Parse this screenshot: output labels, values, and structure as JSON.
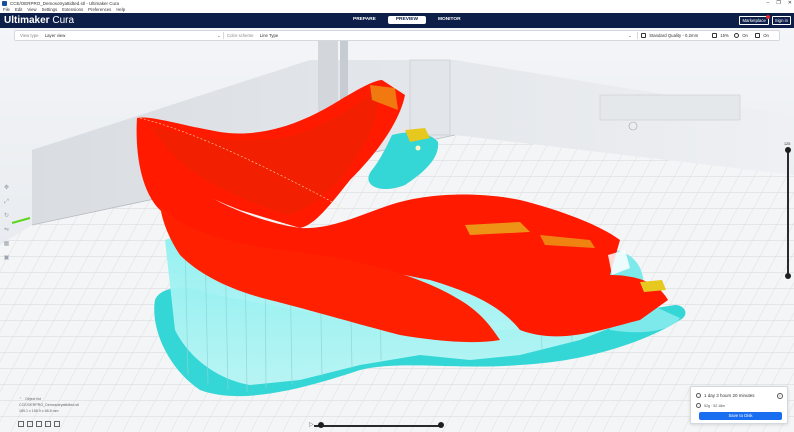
{
  "window": {
    "title": "CCE/OERPRO_Demosotryattidted.stl - Ultimaker Cura",
    "controls": [
      "–",
      "❐",
      "✕"
    ]
  },
  "menu": [
    "File",
    "Edit",
    "View",
    "Settings",
    "Extensions",
    "Preferences",
    "Help"
  ],
  "header": {
    "logo_bold": "Ultimaker",
    "logo_light": "Cura",
    "stages": [
      {
        "label": "PREPARE",
        "active": false
      },
      {
        "label": "PREVIEW",
        "active": true
      },
      {
        "label": "MONITOR",
        "active": false
      }
    ],
    "marketplace": "Marketplace",
    "signin": "Sign in"
  },
  "view_settings": {
    "view_type_label": "View type",
    "view_type_value": "Layer view",
    "color_scheme_label": "Color scheme",
    "color_scheme_value": "Line Type",
    "quality": "Standard Quality - 0.2mm",
    "infill": "15%",
    "support": "On",
    "adhesion": "On"
  },
  "layer_slider": {
    "top_layer": "125",
    "max_layer": 125,
    "current_fraction": 1.0,
    "lower_fraction": 0.0
  },
  "object_info": {
    "header": "Object list",
    "name": "CCE/OERPRO_Demosotryattidted.stl",
    "dims": "189.1 x 158.9 x 68.8 mm"
  },
  "print_panel": {
    "time": "1 day 3 hours 20 minutes",
    "material": "52g · 52.18m",
    "save": "Save to Disk"
  },
  "colors": {
    "header_bg": "#0d1f48",
    "accent": "#196ef0",
    "shell": "#ff1a00",
    "support": "#5ee6e6",
    "infill": "#e6c81e"
  }
}
